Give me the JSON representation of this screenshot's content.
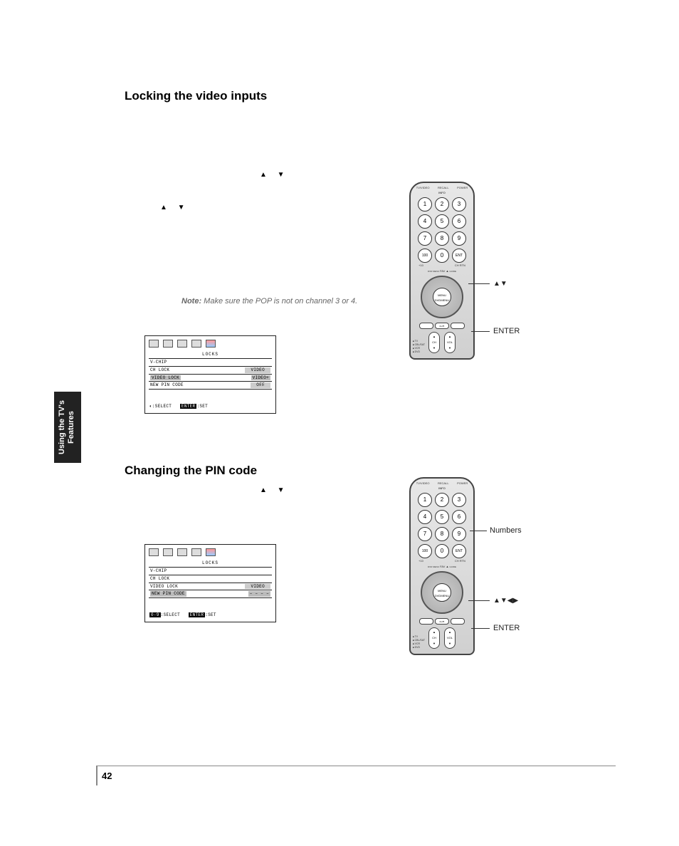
{
  "headings": {
    "lock": "Locking the video inputs",
    "pin": "Changing the PIN code"
  },
  "triangles": {
    "row1": "▲   ▼",
    "row2": "▲   ▼",
    "row3": "▲   ▼"
  },
  "note": {
    "label": "Note:",
    "text": " Make sure the POP is not on channel 3 or 4."
  },
  "osd1": {
    "title": "LOCKS",
    "rows": [
      {
        "left": "V-CHIP",
        "right": ""
      },
      {
        "left": "CH LOCK",
        "right": "VIDEO"
      },
      {
        "left": "VIDEO LOCK",
        "right": "VIDEO+"
      },
      {
        "left": "NEW PIN CODE",
        "right": "OFF"
      }
    ],
    "footer_icon": "◐",
    "footer_select": ":SELECT",
    "footer_enter": "ENTER",
    "footer_set": ":SET"
  },
  "osd2": {
    "title": "LOCKS",
    "rows": [
      {
        "left": "V-CHIP",
        "right": ""
      },
      {
        "left": "CH LOCK",
        "right": ""
      },
      {
        "left": "VIDEO LOCK",
        "right": "VIDEO"
      },
      {
        "left": "NEW PIN CODE",
        "right": "– – – –"
      }
    ],
    "footer_icon": "0-9",
    "footer_select": ":SELECT",
    "footer_enter": "ENTER",
    "footer_set": ":SET"
  },
  "remote": {
    "top_labels": [
      "TV/VIDEO",
      "RECALL",
      "POWER"
    ],
    "info": "INFO",
    "numbers": [
      "1",
      "2",
      "3",
      "4",
      "5",
      "6",
      "7",
      "8",
      "9",
      "100",
      "0",
      "ENT"
    ],
    "sub_left": "+10",
    "sub_right": "CH RTN",
    "fav": "FAV ▲",
    "guide": "GUIDE",
    "dvdmenu": "DVD MENU",
    "center_top": "MENU",
    "center_bottom": "DVDMENU",
    "long": [
      "EXIT",
      "",
      "CH▼",
      "",
      ""
    ],
    "ch": "CH",
    "vol": "VOL",
    "side": [
      "TV",
      "CBL/SAT",
      "VCR",
      "DVD"
    ]
  },
  "callouts": {
    "r1_arrows": "▲▼",
    "r1_enter": "ENTER",
    "r2_num": "Numbers",
    "r2_arrows": "▲▼◀▶",
    "r2_enter": "ENTER"
  },
  "sidetab": {
    "line1": "Using the TV's",
    "line2": "Features"
  },
  "pagenum": "42"
}
